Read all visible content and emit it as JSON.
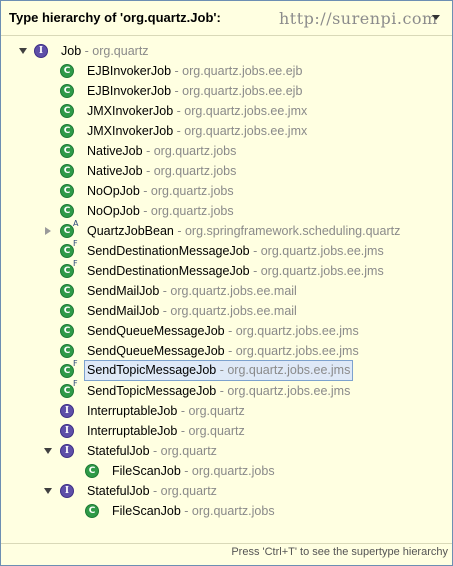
{
  "header": {
    "title": "Type hierarchy of 'org.quartz.Job':",
    "watermark": "http://surenpi.com"
  },
  "tree": {
    "rows": [
      {
        "name": "Job",
        "pkg": " - org.quartz",
        "kind": "interface",
        "mod": "",
        "twisty": "open",
        "level": 0
      },
      {
        "name": "EJBInvokerJob",
        "pkg": " - org.quartz.jobs.ee.ejb",
        "kind": "class",
        "mod": "",
        "twisty": "",
        "level": 1
      },
      {
        "name": "EJBInvokerJob",
        "pkg": " - org.quartz.jobs.ee.ejb",
        "kind": "class",
        "mod": "",
        "twisty": "",
        "level": 1
      },
      {
        "name": "JMXInvokerJob",
        "pkg": " - org.quartz.jobs.ee.jmx",
        "kind": "class",
        "mod": "",
        "twisty": "",
        "level": 1
      },
      {
        "name": "JMXInvokerJob",
        "pkg": " - org.quartz.jobs.ee.jmx",
        "kind": "class",
        "mod": "",
        "twisty": "",
        "level": 1
      },
      {
        "name": "NativeJob",
        "pkg": " - org.quartz.jobs",
        "kind": "class",
        "mod": "",
        "twisty": "",
        "level": 1
      },
      {
        "name": "NativeJob",
        "pkg": " - org.quartz.jobs",
        "kind": "class",
        "mod": "",
        "twisty": "",
        "level": 1
      },
      {
        "name": "NoOpJob",
        "pkg": " - org.quartz.jobs",
        "kind": "class",
        "mod": "",
        "twisty": "",
        "level": 1
      },
      {
        "name": "NoOpJob",
        "pkg": " - org.quartz.jobs",
        "kind": "class",
        "mod": "",
        "twisty": "",
        "level": 1
      },
      {
        "name": "QuartzJobBean",
        "pkg": " - org.springframework.scheduling.quartz",
        "kind": "class",
        "mod": "A",
        "twisty": "closed",
        "level": 1
      },
      {
        "name": "SendDestinationMessageJob",
        "pkg": " - org.quartz.jobs.ee.jms",
        "kind": "class",
        "mod": "F",
        "twisty": "",
        "level": 1
      },
      {
        "name": "SendDestinationMessageJob",
        "pkg": " - org.quartz.jobs.ee.jms",
        "kind": "class",
        "mod": "F",
        "twisty": "",
        "level": 1
      },
      {
        "name": "SendMailJob",
        "pkg": " - org.quartz.jobs.ee.mail",
        "kind": "class",
        "mod": "",
        "twisty": "",
        "level": 1
      },
      {
        "name": "SendMailJob",
        "pkg": " - org.quartz.jobs.ee.mail",
        "kind": "class",
        "mod": "",
        "twisty": "",
        "level": 1
      },
      {
        "name": "SendQueueMessageJob",
        "pkg": " - org.quartz.jobs.ee.jms",
        "kind": "class",
        "mod": "",
        "twisty": "",
        "level": 1
      },
      {
        "name": "SendQueueMessageJob",
        "pkg": " - org.quartz.jobs.ee.jms",
        "kind": "class",
        "mod": "",
        "twisty": "",
        "level": 1
      },
      {
        "name": "SendTopicMessageJob",
        "pkg": " - org.quartz.jobs.ee.jms",
        "kind": "class",
        "mod": "F",
        "twisty": "",
        "level": 1,
        "selected": true
      },
      {
        "name": "SendTopicMessageJob",
        "pkg": " - org.quartz.jobs.ee.jms",
        "kind": "class",
        "mod": "F",
        "twisty": "",
        "level": 1
      },
      {
        "name": "InterruptableJob",
        "pkg": " - org.quartz",
        "kind": "interface",
        "mod": "",
        "twisty": "",
        "level": 1
      },
      {
        "name": "InterruptableJob",
        "pkg": " - org.quartz",
        "kind": "interface",
        "mod": "",
        "twisty": "",
        "level": 1
      },
      {
        "name": "StatefulJob",
        "pkg": " - org.quartz",
        "kind": "interface",
        "mod": "",
        "twisty": "open",
        "level": 1
      },
      {
        "name": "FileScanJob",
        "pkg": " - org.quartz.jobs",
        "kind": "class",
        "mod": "",
        "twisty": "",
        "level": 2
      },
      {
        "name": "StatefulJob",
        "pkg": " - org.quartz",
        "kind": "interface",
        "mod": "",
        "twisty": "open",
        "level": 1
      },
      {
        "name": "FileScanJob",
        "pkg": " - org.quartz.jobs",
        "kind": "class",
        "mod": "",
        "twisty": "",
        "level": 2
      }
    ]
  },
  "status": {
    "text": "Press 'Ctrl+T' to see the supertype hierarchy"
  },
  "icons": {
    "class_glyph": "C",
    "interface_glyph": "I",
    "menu": "chevron-down-icon"
  },
  "colors": {
    "background": "#ffffe1",
    "class_icon": "#2f9a48",
    "interface_icon": "#5e4fa8",
    "package_text": "#8a8a8a",
    "selection": "#dfe9f7"
  }
}
